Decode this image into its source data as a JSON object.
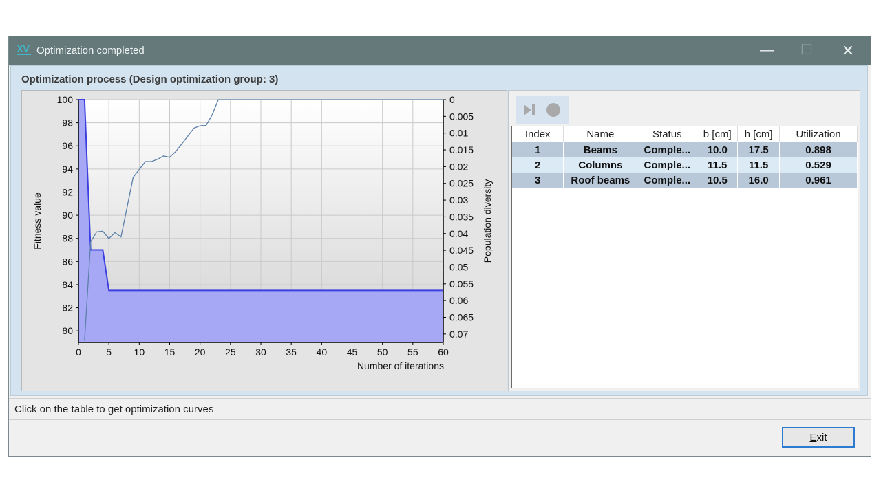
{
  "window": {
    "title": "Optimization completed",
    "controls": {
      "minimize": "—",
      "maximize": "☐",
      "close": "✕"
    },
    "app_icon": "app-logo-icon"
  },
  "group": {
    "title": "Optimization process (Design optimization group: 3)"
  },
  "chart_data": {
    "type": "line",
    "xlabel": "Number of iterations",
    "ylabel": "Fitness value",
    "y2label": "Population diversity",
    "xlim": [
      0,
      60
    ],
    "ylim": [
      79,
      100
    ],
    "y2lim": [
      0,
      0.0725
    ],
    "x_ticks": [
      0,
      5,
      10,
      15,
      20,
      25,
      30,
      35,
      40,
      45,
      50,
      55,
      60
    ],
    "y_ticks": [
      80,
      82,
      84,
      86,
      88,
      90,
      92,
      94,
      96,
      98,
      100
    ],
    "y2_ticks": [
      "0",
      "0.005",
      "0.01",
      "0.015",
      "0.02",
      "0.025",
      "0.03",
      "0.035",
      "0.04",
      "0.045",
      "0.05",
      "0.055",
      "0.06",
      "0.065",
      "0.07"
    ],
    "grid": true,
    "series": [
      {
        "axis": "left",
        "style": "area",
        "color": "#3b3fe0",
        "fill": "#a6a8f5",
        "x": [
          0,
          1,
          2,
          4,
          5,
          60
        ],
        "y": [
          100,
          100,
          87,
          87,
          83.5,
          83.5
        ]
      },
      {
        "axis": "right",
        "style": "line",
        "color": "#5b7fa8",
        "x": [
          1,
          2,
          3,
          4,
          5,
          6,
          7,
          9,
          11,
          12,
          13,
          14,
          15,
          16,
          17,
          19,
          20,
          21,
          22,
          23,
          60
        ],
        "y": [
          0.072,
          0.0425,
          0.0395,
          0.0393,
          0.0415,
          0.0397,
          0.041,
          0.0232,
          0.0185,
          0.0185,
          0.0178,
          0.0168,
          0.0172,
          0.0155,
          0.0132,
          0.0085,
          0.0078,
          0.0077,
          0.0045,
          0.0,
          0.0
        ]
      }
    ]
  },
  "toolbar": {
    "play_icon": "step-play-icon",
    "stop_icon": "stop-icon"
  },
  "table": {
    "columns": [
      "Index",
      "Name",
      "Status",
      "b [cm]",
      "h [cm]",
      "Utilization"
    ],
    "rows": [
      [
        "1",
        "Beams",
        "Comple...",
        "10.0",
        "17.5",
        "0.898"
      ],
      [
        "2",
        "Columns",
        "Comple...",
        "11.5",
        "11.5",
        "0.529"
      ],
      [
        "3",
        "Roof beams",
        "Comple...",
        "10.5",
        "16.0",
        "0.961"
      ]
    ]
  },
  "status": {
    "text": "Click on the table to get optimization curves"
  },
  "buttons": {
    "exit_label": "Exit"
  }
}
